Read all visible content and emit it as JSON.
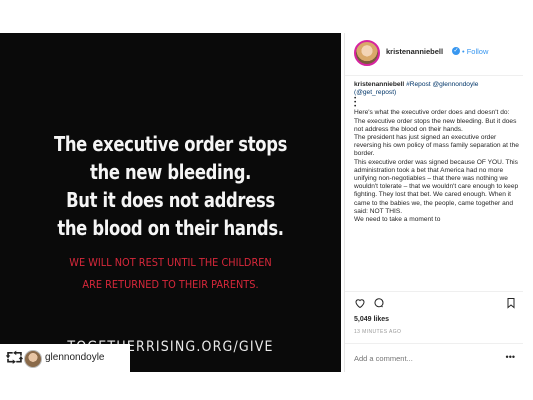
{
  "post": {
    "headline": [
      "The executive order stops",
      "the new bleeding.",
      "But it does not address",
      "the blood on their hands."
    ],
    "subline": [
      "WE WILL NOT REST UNTIL THE CHILDREN",
      "ARE RETURNED TO THEIR PARENTS."
    ],
    "url": "TOGETHERRISING.ORG/GIVE"
  },
  "header": {
    "username": "kristenanniebell",
    "verified": "✓",
    "follow": "• Follow"
  },
  "caption": {
    "username": "kristenanniebell",
    "repost": "#Repost",
    "mention": "@glennondoyle",
    "mention2": "(@get_repost)",
    "dots": [
      "•",
      "•",
      "•"
    ],
    "paragraphs": [
      "Here's what the executive order does and doesn't do: The executive order stops the new bleeding. But it does not address the blood on their hands.",
      "The president has just signed an executive order reversing his own policy of mass family separation at the border.",
      "This executive order was signed because OF YOU. This administration took a bet that America had no more unifying non-negotiables – that there was nothing we wouldn't tolerate – that we wouldn't care enough to keep fighting. They lost that bet. We cared enough. When it came to the babies we, the people, came together and said: NOT THIS.",
      "We need to take a moment to"
    ]
  },
  "actions": {
    "likes": "5,049 likes",
    "time": "13 MINUTES AGO"
  },
  "comment": {
    "placeholder": "Add a comment...",
    "more": "•••"
  },
  "repost": {
    "icon": "⮔",
    "name": "glennondoyle"
  },
  "icons": [
    "heart-icon",
    "comment-icon",
    "bookmark-icon",
    "repost-icon",
    "verified-icon",
    "more-icon"
  ]
}
